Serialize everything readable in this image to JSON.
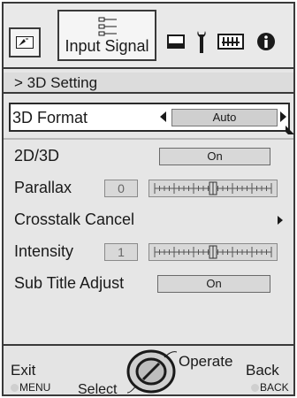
{
  "tabs": {
    "active_label": "Input Signal",
    "icons": [
      "picture-icon",
      "input-signal-icon",
      "display-icon",
      "setup-wrench-icon",
      "option-menu-icon",
      "info-icon"
    ]
  },
  "breadcrumb": {
    "text": "> 3D Setting"
  },
  "settings": {
    "format": {
      "label": "3D Format",
      "value": "Auto"
    },
    "mode": {
      "label": "2D/3D",
      "value": "On"
    },
    "parallax": {
      "label": "Parallax",
      "value": "0",
      "level": 0.5
    },
    "crosstalk": {
      "label": "Crosstalk Cancel"
    },
    "intensity": {
      "label": "Intensity",
      "value": "1",
      "level": 0.5
    },
    "subtitle": {
      "label": "Sub Title Adjust",
      "value": "On"
    }
  },
  "controls": {
    "exit": "Exit",
    "menu": "MENU",
    "select": "Select",
    "operate": "Operate",
    "back": "Back",
    "back_key": "BACK"
  }
}
